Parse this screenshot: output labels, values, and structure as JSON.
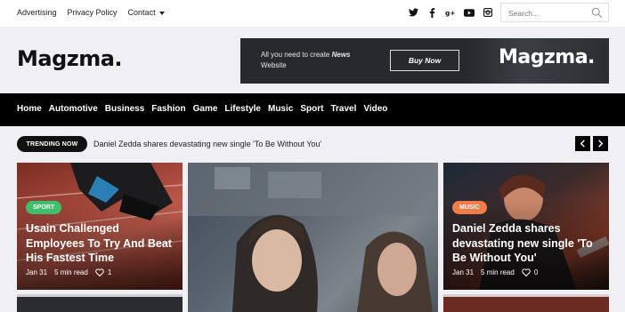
{
  "topbar": {
    "links": [
      "Advertising",
      "Privacy Policy",
      "Contact"
    ],
    "social_icons": [
      "twitter-icon",
      "facebook-icon",
      "google-plus-icon",
      "youtube-icon",
      "instagram-icon"
    ],
    "search_placeholder": "Search..."
  },
  "header": {
    "logo": "Magzma.",
    "banner": {
      "text_prefix": "All you need to create ",
      "text_bold": "News",
      "text_suffix": "Website",
      "button": "Buy Now",
      "logo": "Magzma."
    }
  },
  "nav": {
    "items": [
      "Home",
      "Automotive",
      "Business",
      "Fashion",
      "Game",
      "Lifestyle",
      "Music",
      "Sport",
      "Travel",
      "Video"
    ]
  },
  "trending": {
    "label": "TRENDING NOW",
    "headline": "Daniel Zedda shares devastating new single 'To Be Without You'"
  },
  "cards": [
    {
      "category": "SPORT",
      "category_color": "#3fbf6c",
      "title": "Usain Challenged Employees To Try And Beat His Fastest Time",
      "date": "Jan 31",
      "read": "5 min read",
      "likes": "1"
    },
    {
      "category": "",
      "title": "",
      "date": "",
      "read": "",
      "likes": ""
    },
    {
      "category": "MUSIC",
      "category_color": "#f07c4a",
      "title": "Daniel Zedda shares devastating new single 'To Be Without You'",
      "date": "Jan 31",
      "read": "5 min read",
      "likes": "0"
    }
  ]
}
